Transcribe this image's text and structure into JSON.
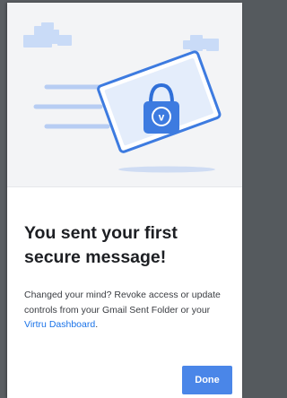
{
  "dialog": {
    "title": "You sent your first secure message!",
    "body_prefix": "Changed your mind? Revoke access or update controls from your Gmail Sent Folder or your ",
    "link_text": "Virtru Dashboard",
    "body_suffix": ".",
    "done_label": "Done"
  },
  "illustration": {
    "lock_letter": "v",
    "icons": [
      "cloud-icon",
      "cloud-icon",
      "speed-lines-icon",
      "envelope-icon",
      "padlock-icon",
      "shadow-ellipse"
    ]
  },
  "colors": {
    "accent": "#4a86e8",
    "link": "#1a73e8",
    "hero_background": "#f3f4f6",
    "illustration_light_blue": "#c9dbf7",
    "illustration_dark_blue": "#3d7be0"
  }
}
